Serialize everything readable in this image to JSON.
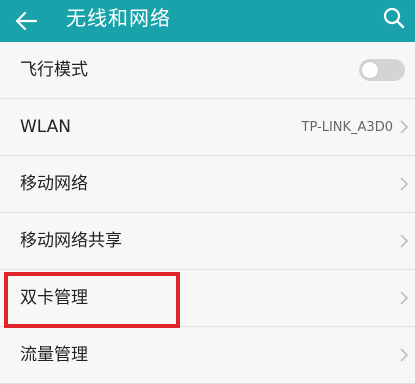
{
  "header": {
    "title": "无线和网络",
    "back_icon": "arrow-left-icon",
    "search_icon": "search-icon",
    "color": "#19a2a9"
  },
  "settings": {
    "airplane_mode": {
      "label": "飞行模式",
      "toggle_state": "off"
    },
    "wlan": {
      "label": "WLAN",
      "value": "TP-LINK_A3D0"
    },
    "mobile_network": {
      "label": "移动网络"
    },
    "tethering": {
      "label": "移动网络共享"
    },
    "dual_sim": {
      "label": "双卡管理",
      "highlighted": true,
      "highlight_color": "#e0232b"
    },
    "data_usage": {
      "label": "流量管理"
    }
  }
}
